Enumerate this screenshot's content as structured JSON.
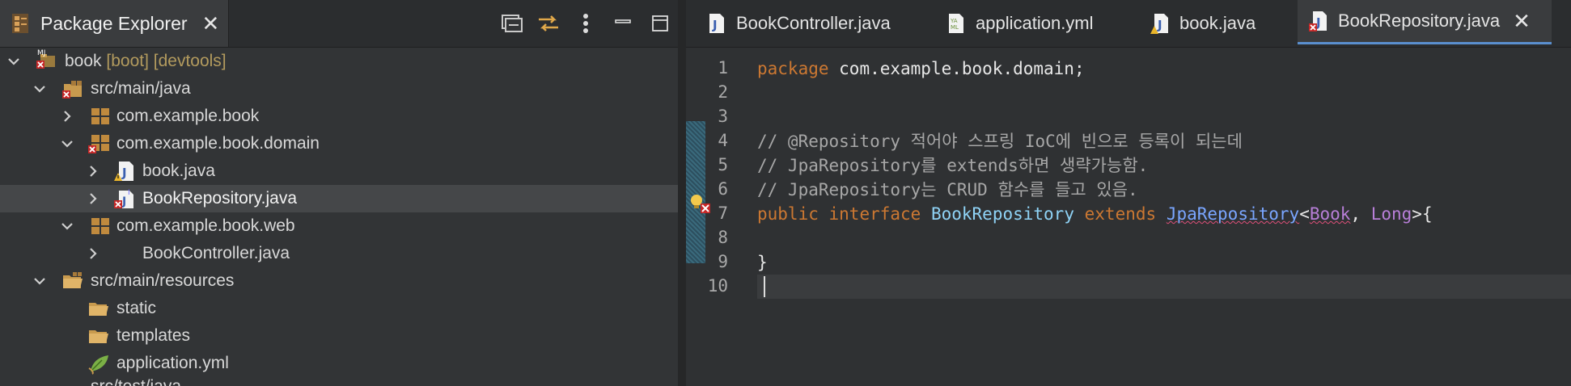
{
  "package_explorer": {
    "tab_title": "Package Explorer",
    "tools": [
      "collapse-all-icon",
      "link-with-editor-icon",
      "view-menu-icon",
      "minimize-icon",
      "maximize-icon"
    ],
    "tree": [
      {
        "label": "book",
        "deco": " [boot] [devtools]",
        "expanded": true,
        "depth": 0,
        "icon": "maven-project-icon"
      },
      {
        "label": "src/main/java",
        "expanded": true,
        "depth": 1,
        "icon": "source-folder-error-icon"
      },
      {
        "label": "com.example.book",
        "expanded": false,
        "depth": 2,
        "icon": "package-icon"
      },
      {
        "label": "com.example.book.domain",
        "expanded": true,
        "depth": 2,
        "icon": "package-error-icon"
      },
      {
        "label": "book.java",
        "expanded": false,
        "depth": 3,
        "icon": "java-file-warning-icon"
      },
      {
        "label": "BookRepository.java",
        "expanded": false,
        "depth": 3,
        "icon": "java-interface-error-icon",
        "selected": true
      },
      {
        "label": "com.example.book.web",
        "expanded": true,
        "depth": 2,
        "icon": "package-icon"
      },
      {
        "label": "BookController.java",
        "expanded": false,
        "depth": 3,
        "icon": "java-file-icon"
      },
      {
        "label": "src/main/resources",
        "expanded": true,
        "depth": 1,
        "icon": "resource-folder-icon"
      },
      {
        "label": "static",
        "depth": 2,
        "icon": "folder-icon"
      },
      {
        "label": "templates",
        "depth": 2,
        "icon": "folder-icon"
      },
      {
        "label": "application.yml",
        "depth": 2,
        "icon": "spring-yml-icon"
      },
      {
        "label": "src/test/java",
        "expanded": false,
        "depth": 1,
        "icon": "source-folder-icon"
      }
    ]
  },
  "editor": {
    "tabs": [
      {
        "label": "BookController.java",
        "icon": "java-file-icon"
      },
      {
        "label": "application.yml",
        "icon": "yml-file-icon"
      },
      {
        "label": "book.java",
        "icon": "java-file-warning-icon"
      },
      {
        "label": "BookRepository.java",
        "icon": "java-file-error-icon",
        "active": true
      }
    ],
    "lines": [
      {
        "n": "1"
      },
      {
        "n": "2"
      },
      {
        "n": "3"
      },
      {
        "n": "4"
      },
      {
        "n": "5"
      },
      {
        "n": "6"
      },
      {
        "n": "7"
      },
      {
        "n": "8"
      },
      {
        "n": "9"
      },
      {
        "n": "10"
      }
    ],
    "code": {
      "l1_kw": "package",
      "l1_rest": " com.example.book.domain;",
      "l4": "// @Repository 적어야 스프링 IoC에 빈으로 등록이 되는데",
      "l5": "// JpaRepository를 extends하면 생략가능함.",
      "l6": "// JpaRepository는 CRUD 함수를 들고 있음.",
      "l7_public": "public",
      "l7_interface": "interface",
      "l7_name": "BookRepository",
      "l7_extends": "extends",
      "l7_super": "JpaRepository",
      "l7_lt": "<",
      "l7_t1": "Book",
      "l7_comma": ", ",
      "l7_t2": "Long",
      "l7_end": ">{",
      "l9": "}"
    }
  },
  "colors": {
    "keyword": "#cc7832",
    "interface_name": "#8fd3f6",
    "type": "#b87fd8",
    "comment": "#a7a7a7",
    "error_underline": "#e0507a",
    "active_tab_underline": "#5a8fcf"
  }
}
